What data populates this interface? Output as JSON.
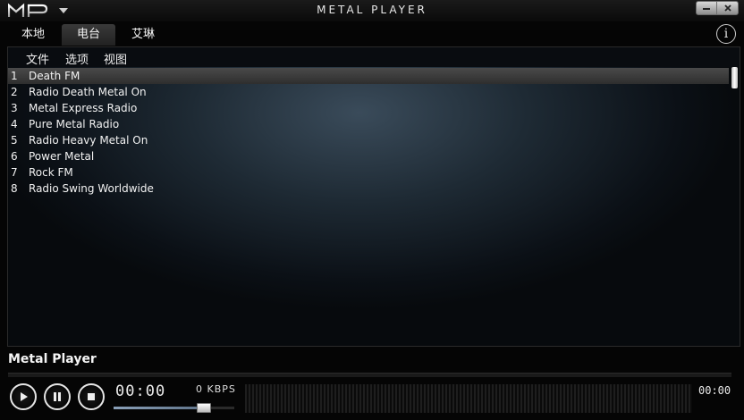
{
  "titlebar": {
    "logo_icon": "mp-logo-icon",
    "app_title": "METAL PLAYER"
  },
  "tabs": [
    {
      "label": "本地",
      "active": false
    },
    {
      "label": "电台",
      "active": true
    },
    {
      "label": "艾琳",
      "active": false
    }
  ],
  "menu": [
    {
      "label": "文件"
    },
    {
      "label": "选项"
    },
    {
      "label": "视图"
    }
  ],
  "stations": [
    {
      "num": "1",
      "name": "Death FM",
      "selected": true
    },
    {
      "num": "2",
      "name": "Radio Death Metal On"
    },
    {
      "num": "3",
      "name": "Metal Express Radio"
    },
    {
      "num": "4",
      "name": "Pure Metal Radio"
    },
    {
      "num": "5",
      "name": "Radio Heavy Metal On"
    },
    {
      "num": "6",
      "name": "Power Metal"
    },
    {
      "num": "7",
      "name": "Rock FM"
    },
    {
      "num": "8",
      "name": "Radio Swing Worldwide"
    }
  ],
  "player": {
    "now_playing": "Metal Player",
    "elapsed": "00:00",
    "bitrate": "0 KBPS",
    "total": "00:00",
    "volume_level": 0.75
  },
  "colors": {
    "panel_highlight": "#3a4b5a",
    "selected_row": "#4a4a4a"
  }
}
